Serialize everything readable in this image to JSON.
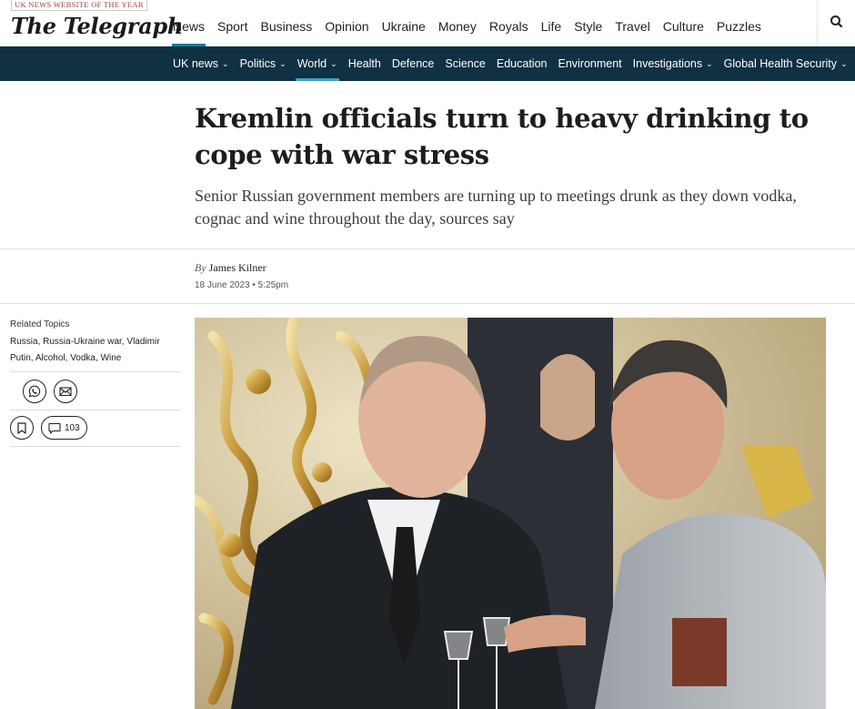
{
  "header": {
    "award": "UK NEWS WEBSITE OF THE YEAR",
    "logo": "The Telegraph",
    "nav": [
      "News",
      "Sport",
      "Business",
      "Opinion",
      "Ukraine",
      "Money",
      "Royals",
      "Life",
      "Style",
      "Travel",
      "Culture",
      "Puzzles"
    ],
    "active_nav": "News",
    "search_icon": "search-icon"
  },
  "subnav": {
    "items": [
      {
        "label": "UK news",
        "dropdown": true
      },
      {
        "label": "Politics",
        "dropdown": true
      },
      {
        "label": "World",
        "dropdown": true
      },
      {
        "label": "Health",
        "dropdown": false
      },
      {
        "label": "Defence",
        "dropdown": false
      },
      {
        "label": "Science",
        "dropdown": false
      },
      {
        "label": "Education",
        "dropdown": false
      },
      {
        "label": "Environment",
        "dropdown": false
      },
      {
        "label": "Investigations",
        "dropdown": true
      },
      {
        "label": "Global Health Security",
        "dropdown": true
      }
    ],
    "active": "World",
    "bg_color": "#0f3142"
  },
  "article": {
    "headline": "Kremlin officials turn to heavy drinking to cope with war stress",
    "standfirst": "Senior Russian government members are turning up to meetings drunk as they down vodka, cognac and wine throughout the day, sources say",
    "byline_prefix": "By",
    "author": "James Kilner",
    "date": "18 June 2023 • 5:25pm"
  },
  "sidebar": {
    "related_label": "Related Topics",
    "topics": [
      "Russia",
      "Russia-Ukraine war",
      "Vladimir Putin",
      "Alcohol",
      "Vodka",
      "Wine"
    ],
    "share_icons": [
      "whatsapp-icon",
      "email-icon"
    ],
    "bookmark_icon": "bookmark-icon",
    "comment_count": "103"
  }
}
